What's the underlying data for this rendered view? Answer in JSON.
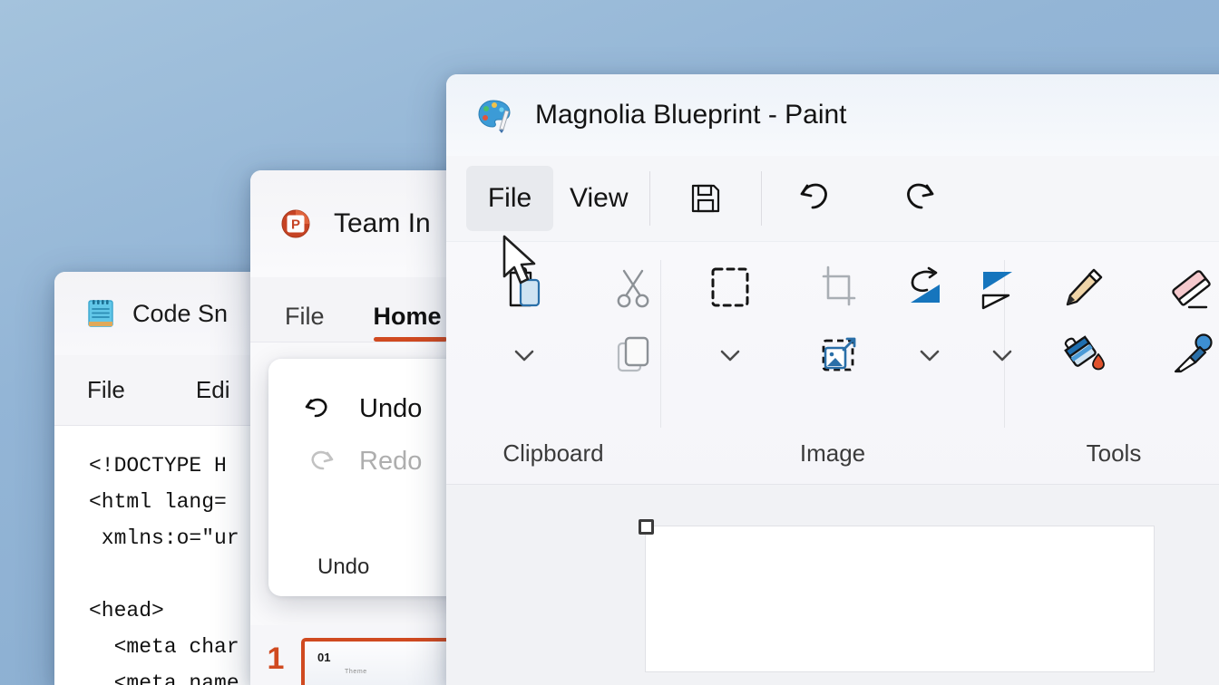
{
  "desktop": {
    "background_color": "#93b5d6"
  },
  "code_window": {
    "icon": "notepad-icon",
    "title": "Code Sn",
    "menus": [
      {
        "label": "File"
      },
      {
        "label": "Edi"
      }
    ],
    "code": "<!DOCTYPE H\n<html lang=\n xmlns:o=\"ur\n\n<head>\n  <meta char\n  <meta name"
  },
  "ppt_window": {
    "icon": "powerpoint-icon",
    "title": "Team In",
    "tabs": [
      {
        "label": "File",
        "active": false
      },
      {
        "label": "Home",
        "active": true
      }
    ],
    "accent_color": "#d04a20",
    "undo_flyout": {
      "items": [
        {
          "label": "Undo",
          "icon": "undo-arrow-icon",
          "disabled": false
        },
        {
          "label": "Redo",
          "icon": "redo-arrow-icon",
          "disabled": true
        }
      ],
      "caption": "Undo"
    },
    "slide_panel": {
      "number": "1",
      "thumb_title": "01",
      "thumb_sub": "Theme"
    }
  },
  "paint_window": {
    "icon": "paint-palette-icon",
    "title": "Magnolia Blueprint - Paint",
    "toolbar": {
      "file_label": "File",
      "view_label": "View",
      "save_icon": "floppy-save-icon",
      "undo_icon": "undo-arrow-icon",
      "redo_icon": "redo-arrow-icon"
    },
    "ribbon_groups": [
      {
        "label": "Clipboard",
        "items": [
          {
            "name": "paste-icon"
          },
          {
            "name": "paste-dropdown-chevron-icon"
          },
          {
            "name": "cut-scissors-icon"
          },
          {
            "name": "copy-icon"
          }
        ]
      },
      {
        "label": "Image",
        "items": [
          {
            "name": "select-rectangle-icon"
          },
          {
            "name": "select-dropdown-chevron-icon"
          },
          {
            "name": "crop-icon"
          },
          {
            "name": "resize-image-icon"
          },
          {
            "name": "rotate-icon"
          },
          {
            "name": "rotate-dropdown-chevron-icon"
          },
          {
            "name": "flip-icon"
          },
          {
            "name": "flip-dropdown-chevron-icon"
          }
        ]
      },
      {
        "label": "Tools",
        "items": [
          {
            "name": "pencil-icon"
          },
          {
            "name": "fill-bucket-icon"
          },
          {
            "name": "eraser-icon"
          },
          {
            "name": "eyedropper-icon"
          }
        ]
      }
    ],
    "canvas": {
      "handle": "canvas-resize-handle"
    }
  },
  "cursor": {
    "name": "mouse-pointer"
  }
}
